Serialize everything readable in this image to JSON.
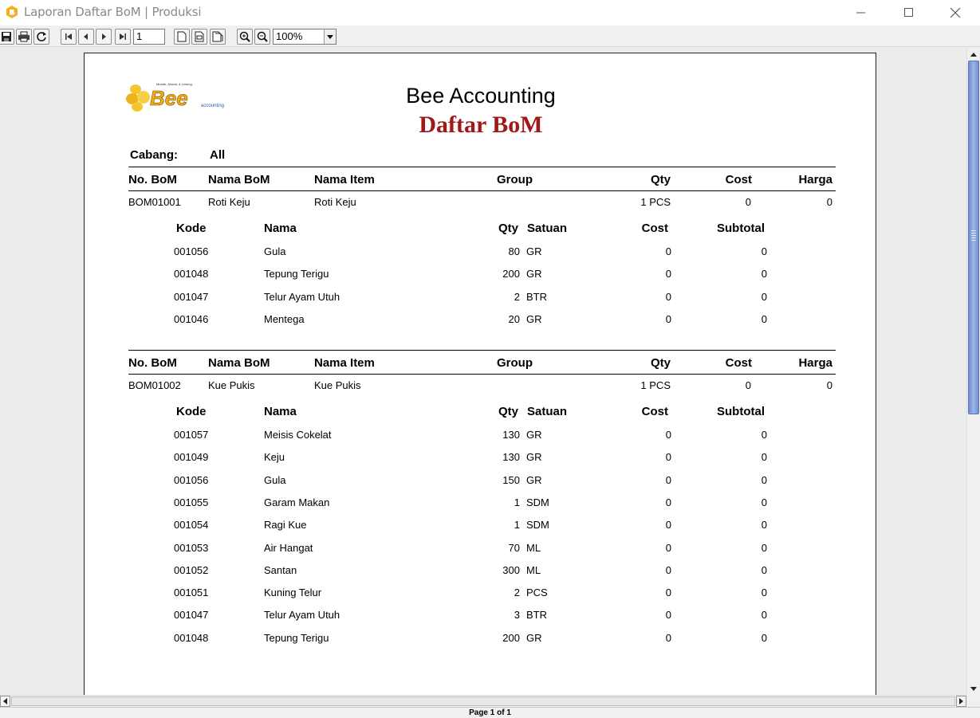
{
  "window": {
    "title": "Laporan Daftar BoM | Produksi"
  },
  "toolbar": {
    "page_value": "1",
    "zoom_value": "100%"
  },
  "status": {
    "page_text": "Page 1 of 1"
  },
  "report": {
    "logo_text": "Bee",
    "logo_tagline": "Mudah, Akurat, & Untung.",
    "logo_sub": "accounting",
    "company": "Bee Accounting",
    "title": "Daftar BoM",
    "branch_label": "Cabang:",
    "branch_value": "All",
    "header": {
      "no": "No. BoM",
      "nama_bom": "Nama BoM",
      "nama_item": "Nama Item",
      "group": "Group",
      "qty": "Qty",
      "cost": "Cost",
      "harga": "Harga"
    },
    "detail_header": {
      "kode": "Kode",
      "nama": "Nama",
      "qty": "Qty",
      "satuan": "Satuan",
      "cost": "Cost",
      "subtotal": "Subtotal"
    },
    "boms": [
      {
        "no": "BOM01001",
        "nama_bom": "Roti Keju",
        "nama_item": "Roti Keju",
        "group": "",
        "qty": "1 PCS",
        "cost": "0",
        "harga": "0",
        "items": [
          {
            "kode": "001056",
            "nama": "Gula",
            "qty": "80",
            "satuan": "GR",
            "cost": "0",
            "subtotal": "0"
          },
          {
            "kode": "001048",
            "nama": "Tepung Terigu",
            "qty": "200",
            "satuan": "GR",
            "cost": "0",
            "subtotal": "0"
          },
          {
            "kode": "001047",
            "nama": "Telur Ayam Utuh",
            "qty": "2",
            "satuan": "BTR",
            "cost": "0",
            "subtotal": "0"
          },
          {
            "kode": "001046",
            "nama": "Mentega",
            "qty": "20",
            "satuan": "GR",
            "cost": "0",
            "subtotal": "0"
          }
        ]
      },
      {
        "no": "BOM01002",
        "nama_bom": "Kue Pukis",
        "nama_item": "Kue Pukis",
        "group": "",
        "qty": "1 PCS",
        "cost": "0",
        "harga": "0",
        "items": [
          {
            "kode": "001057",
            "nama": "Meisis Cokelat",
            "qty": "130",
            "satuan": "GR",
            "cost": "0",
            "subtotal": "0"
          },
          {
            "kode": "001049",
            "nama": "Keju",
            "qty": "130",
            "satuan": "GR",
            "cost": "0",
            "subtotal": "0"
          },
          {
            "kode": "001056",
            "nama": "Gula",
            "qty": "150",
            "satuan": "GR",
            "cost": "0",
            "subtotal": "0"
          },
          {
            "kode": "001055",
            "nama": "Garam Makan",
            "qty": "1",
            "satuan": "SDM",
            "cost": "0",
            "subtotal": "0"
          },
          {
            "kode": "001054",
            "nama": "Ragi Kue",
            "qty": "1",
            "satuan": "SDM",
            "cost": "0",
            "subtotal": "0"
          },
          {
            "kode": "001053",
            "nama": "Air Hangat",
            "qty": "70",
            "satuan": "ML",
            "cost": "0",
            "subtotal": "0"
          },
          {
            "kode": "001052",
            "nama": "Santan",
            "qty": "300",
            "satuan": "ML",
            "cost": "0",
            "subtotal": "0"
          },
          {
            "kode": "001051",
            "nama": "Kuning Telur",
            "qty": "2",
            "satuan": "PCS",
            "cost": "0",
            "subtotal": "0"
          },
          {
            "kode": "001047",
            "nama": "Telur Ayam Utuh",
            "qty": "3",
            "satuan": "BTR",
            "cost": "0",
            "subtotal": "0"
          },
          {
            "kode": "001048",
            "nama": "Tepung Terigu",
            "qty": "200",
            "satuan": "GR",
            "cost": "0",
            "subtotal": "0"
          }
        ]
      }
    ]
  }
}
